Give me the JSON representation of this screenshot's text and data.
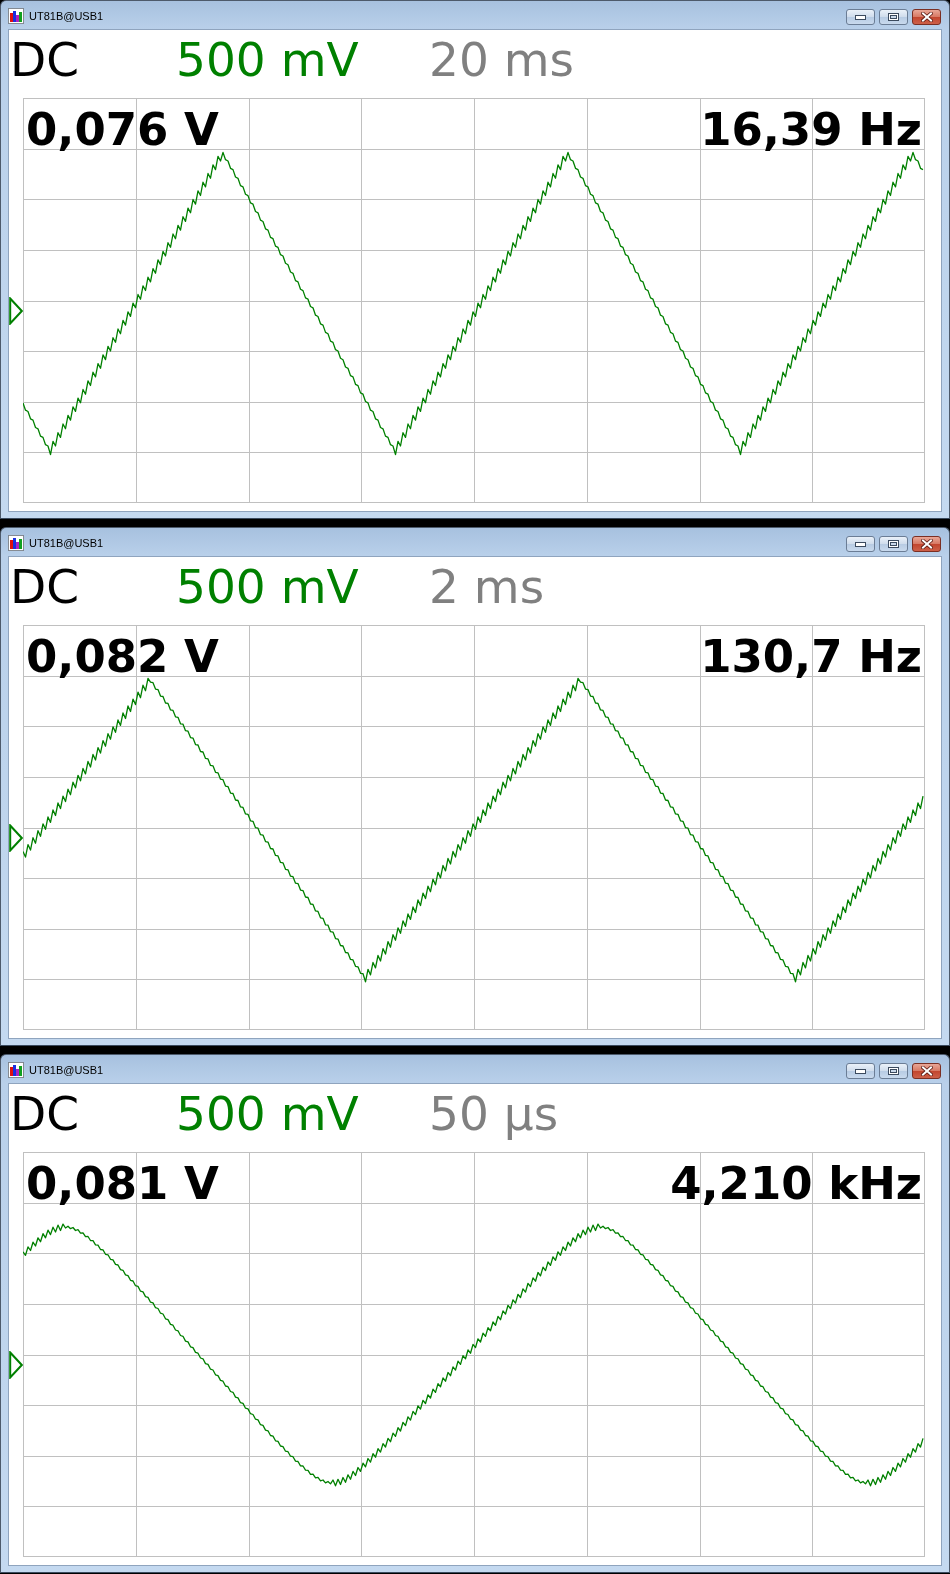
{
  "windows": [
    {
      "title": "UT81B@USB1",
      "coupling": "DC",
      "volts_per_div": "500 mV",
      "time_per_div": "20 ms",
      "voltage_reading": "0,076 V",
      "frequency_reading": "16,39 Hz"
    },
    {
      "title": "UT81B@USB1",
      "coupling": "DC",
      "volts_per_div": "500 mV",
      "time_per_div": "2 ms",
      "voltage_reading": "0,082 V",
      "frequency_reading": "130,7 Hz"
    },
    {
      "title": "UT81B@USB1",
      "coupling": "DC",
      "volts_per_div": "500 mV",
      "time_per_div": "50 µs",
      "voltage_reading": "0,081 V",
      "frequency_reading": "4,210 kHz"
    }
  ]
}
